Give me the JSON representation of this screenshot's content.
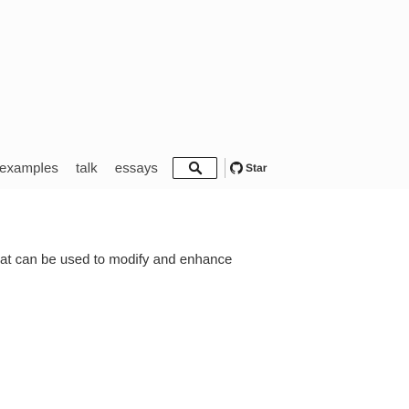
{
  "navbar": {
    "links": [
      {
        "label": "examples"
      },
      {
        "label": "talk"
      },
      {
        "label": "essays"
      }
    ],
    "search_icon": "search-icon",
    "star": {
      "icon": "github-icon",
      "label": "Star"
    }
  },
  "content": {
    "text": "at can be used to modify and enhance"
  }
}
